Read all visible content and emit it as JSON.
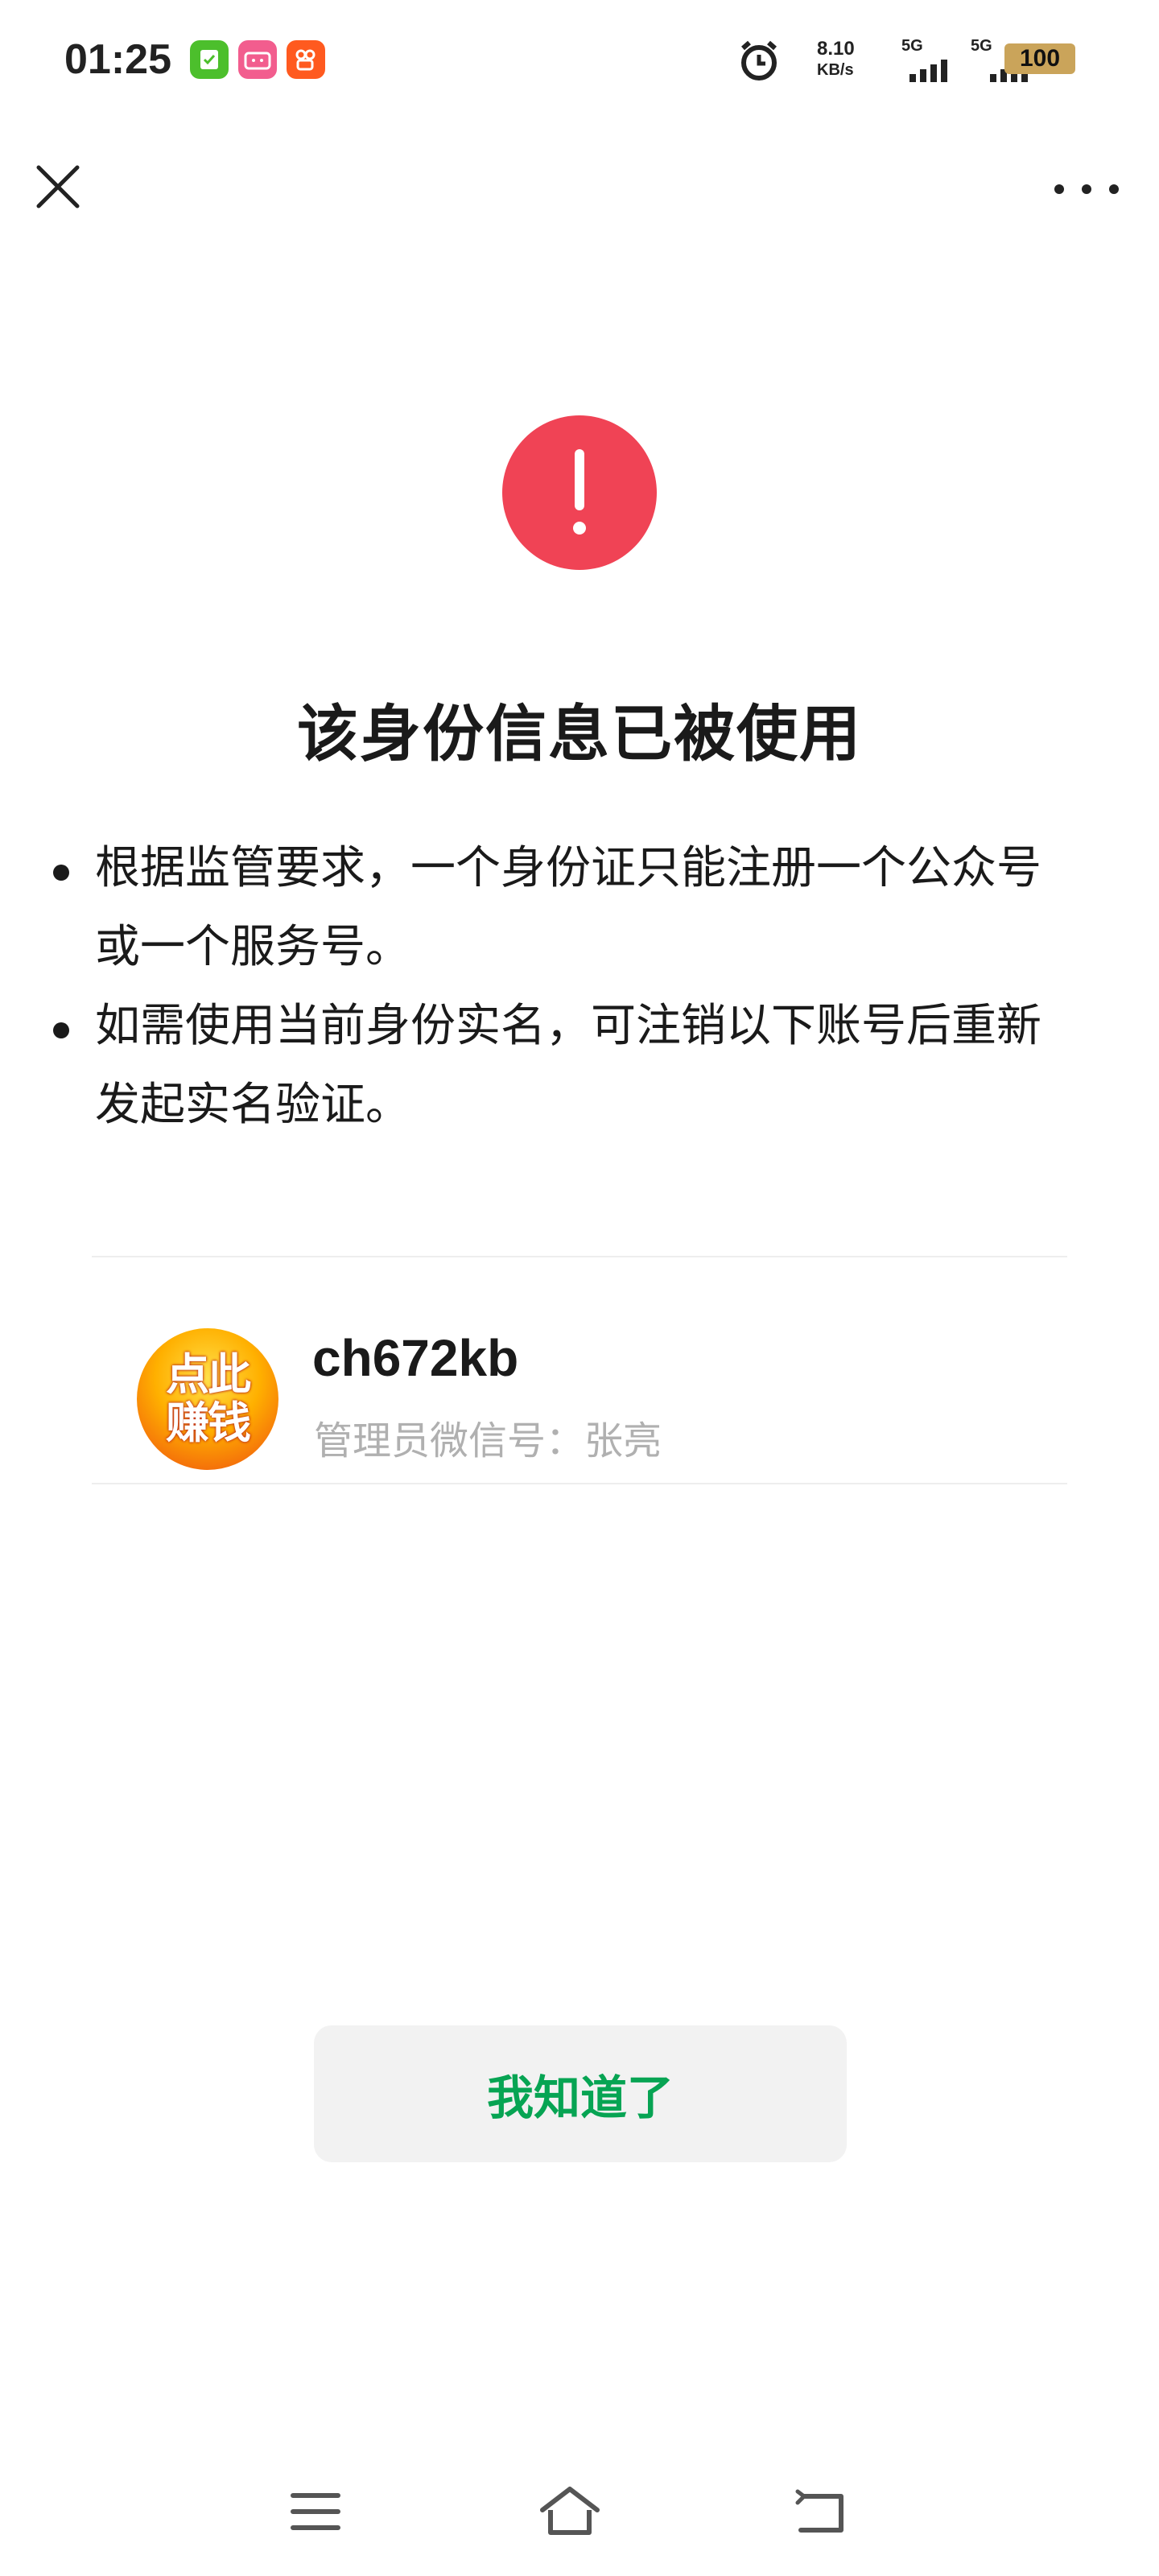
{
  "status_bar": {
    "time": "01:25",
    "net_speed_value": "8.10",
    "net_speed_unit": "KB/s",
    "sim1_label": "5G",
    "sim2_label": "5G",
    "battery": "100",
    "app_icons": [
      "check-app-icon",
      "bilibili-icon",
      "kuaishou-icon"
    ],
    "colors": {
      "check_app": "#4cbf2c",
      "bilibili": "#f25d8e",
      "kuaishou": "#ff5a1f",
      "battery": "#caa45a"
    }
  },
  "nav": {
    "close_icon": "close-icon",
    "more_icon": "more-icon"
  },
  "warning": {
    "icon": "exclamation-icon",
    "color": "#f04355",
    "title": "该身份信息已被使用",
    "bullets": [
      "根据监管要求，一个身份证只能注册一个公众号或一个服务号。",
      "如需使用当前身份实名，可注销以下账号后重新发起实名验证。"
    ]
  },
  "account": {
    "avatar_text_line1": "点此",
    "avatar_text_line2": "赚钱",
    "name": "ch672kb",
    "admin": "管理员微信号：张亮"
  },
  "actions": {
    "ok_label": "我知道了",
    "ok_color": "#07a453"
  },
  "bottom_nav": [
    "menu-icon",
    "home-icon",
    "back-icon"
  ]
}
